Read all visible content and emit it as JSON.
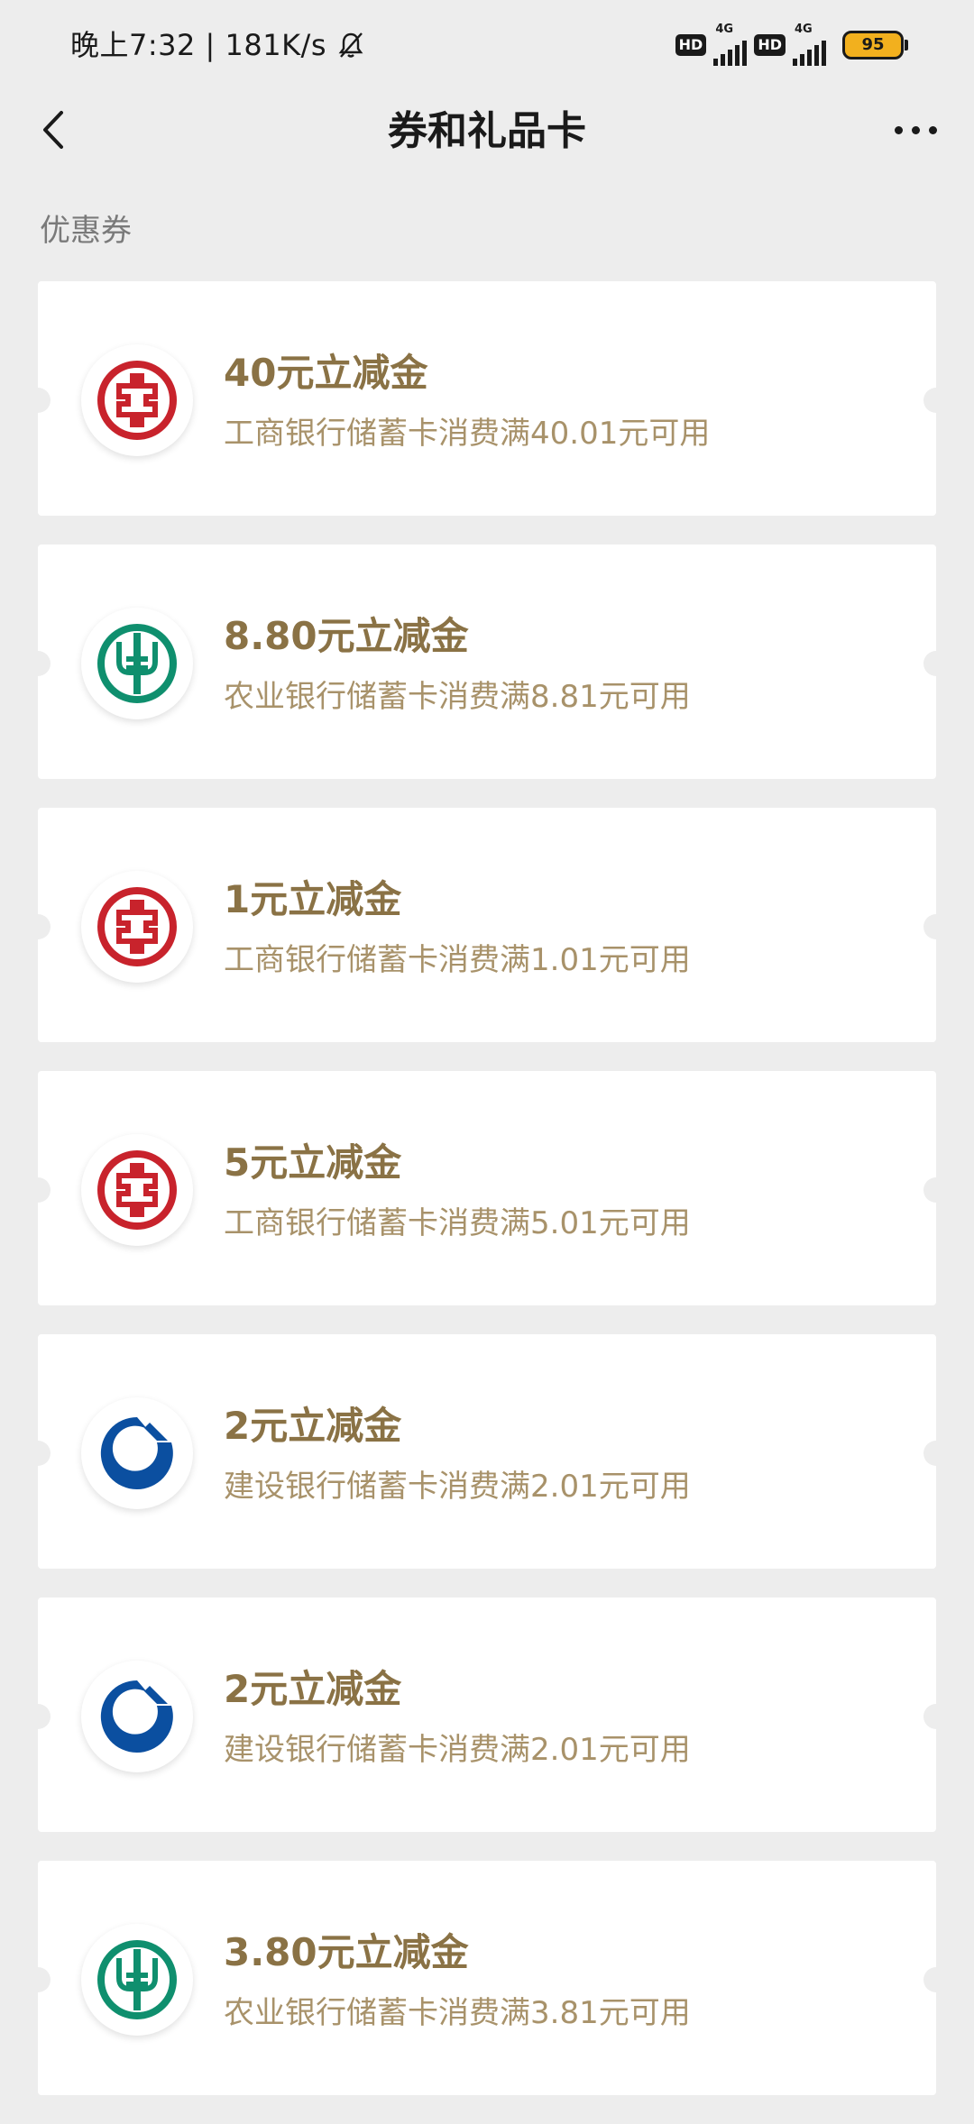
{
  "status_bar": {
    "time_speed": "晚上7:32 | 181K/s",
    "hd1": "HD",
    "net1": "4G",
    "hd2": "HD",
    "net2": "4G",
    "battery": "95"
  },
  "nav": {
    "title": "券和礼品卡",
    "back_icon": "chevron-left-icon",
    "more_icon": "more-dots-icon"
  },
  "section": {
    "label": "优惠券"
  },
  "coupons": [
    {
      "bank": "icbc",
      "title": "40元立减金",
      "desc": "工商银行储蓄卡消费满40.01元可用"
    },
    {
      "bank": "abc",
      "title": "8.80元立减金",
      "desc": "农业银行储蓄卡消费满8.81元可用"
    },
    {
      "bank": "icbc",
      "title": "1元立减金",
      "desc": "工商银行储蓄卡消费满1.01元可用"
    },
    {
      "bank": "icbc",
      "title": "5元立减金",
      "desc": "工商银行储蓄卡消费满5.01元可用"
    },
    {
      "bank": "ccb",
      "title": "2元立减金",
      "desc": "建设银行储蓄卡消费满2.01元可用"
    },
    {
      "bank": "ccb",
      "title": "2元立减金",
      "desc": "建设银行储蓄卡消费满2.01元可用"
    },
    {
      "bank": "abc",
      "title": "3.80元立减金",
      "desc": "农业银行储蓄卡消费满3.81元可用"
    }
  ],
  "colors": {
    "background": "#ededed",
    "card": "#ffffff",
    "title_gold": "#8a7245",
    "desc_gold": "#a8926a",
    "icbc_red": "#c8232c",
    "abc_green": "#0f8f6e",
    "ccb_blue": "#0b4fa0",
    "battery_fill": "#f2b01e"
  }
}
